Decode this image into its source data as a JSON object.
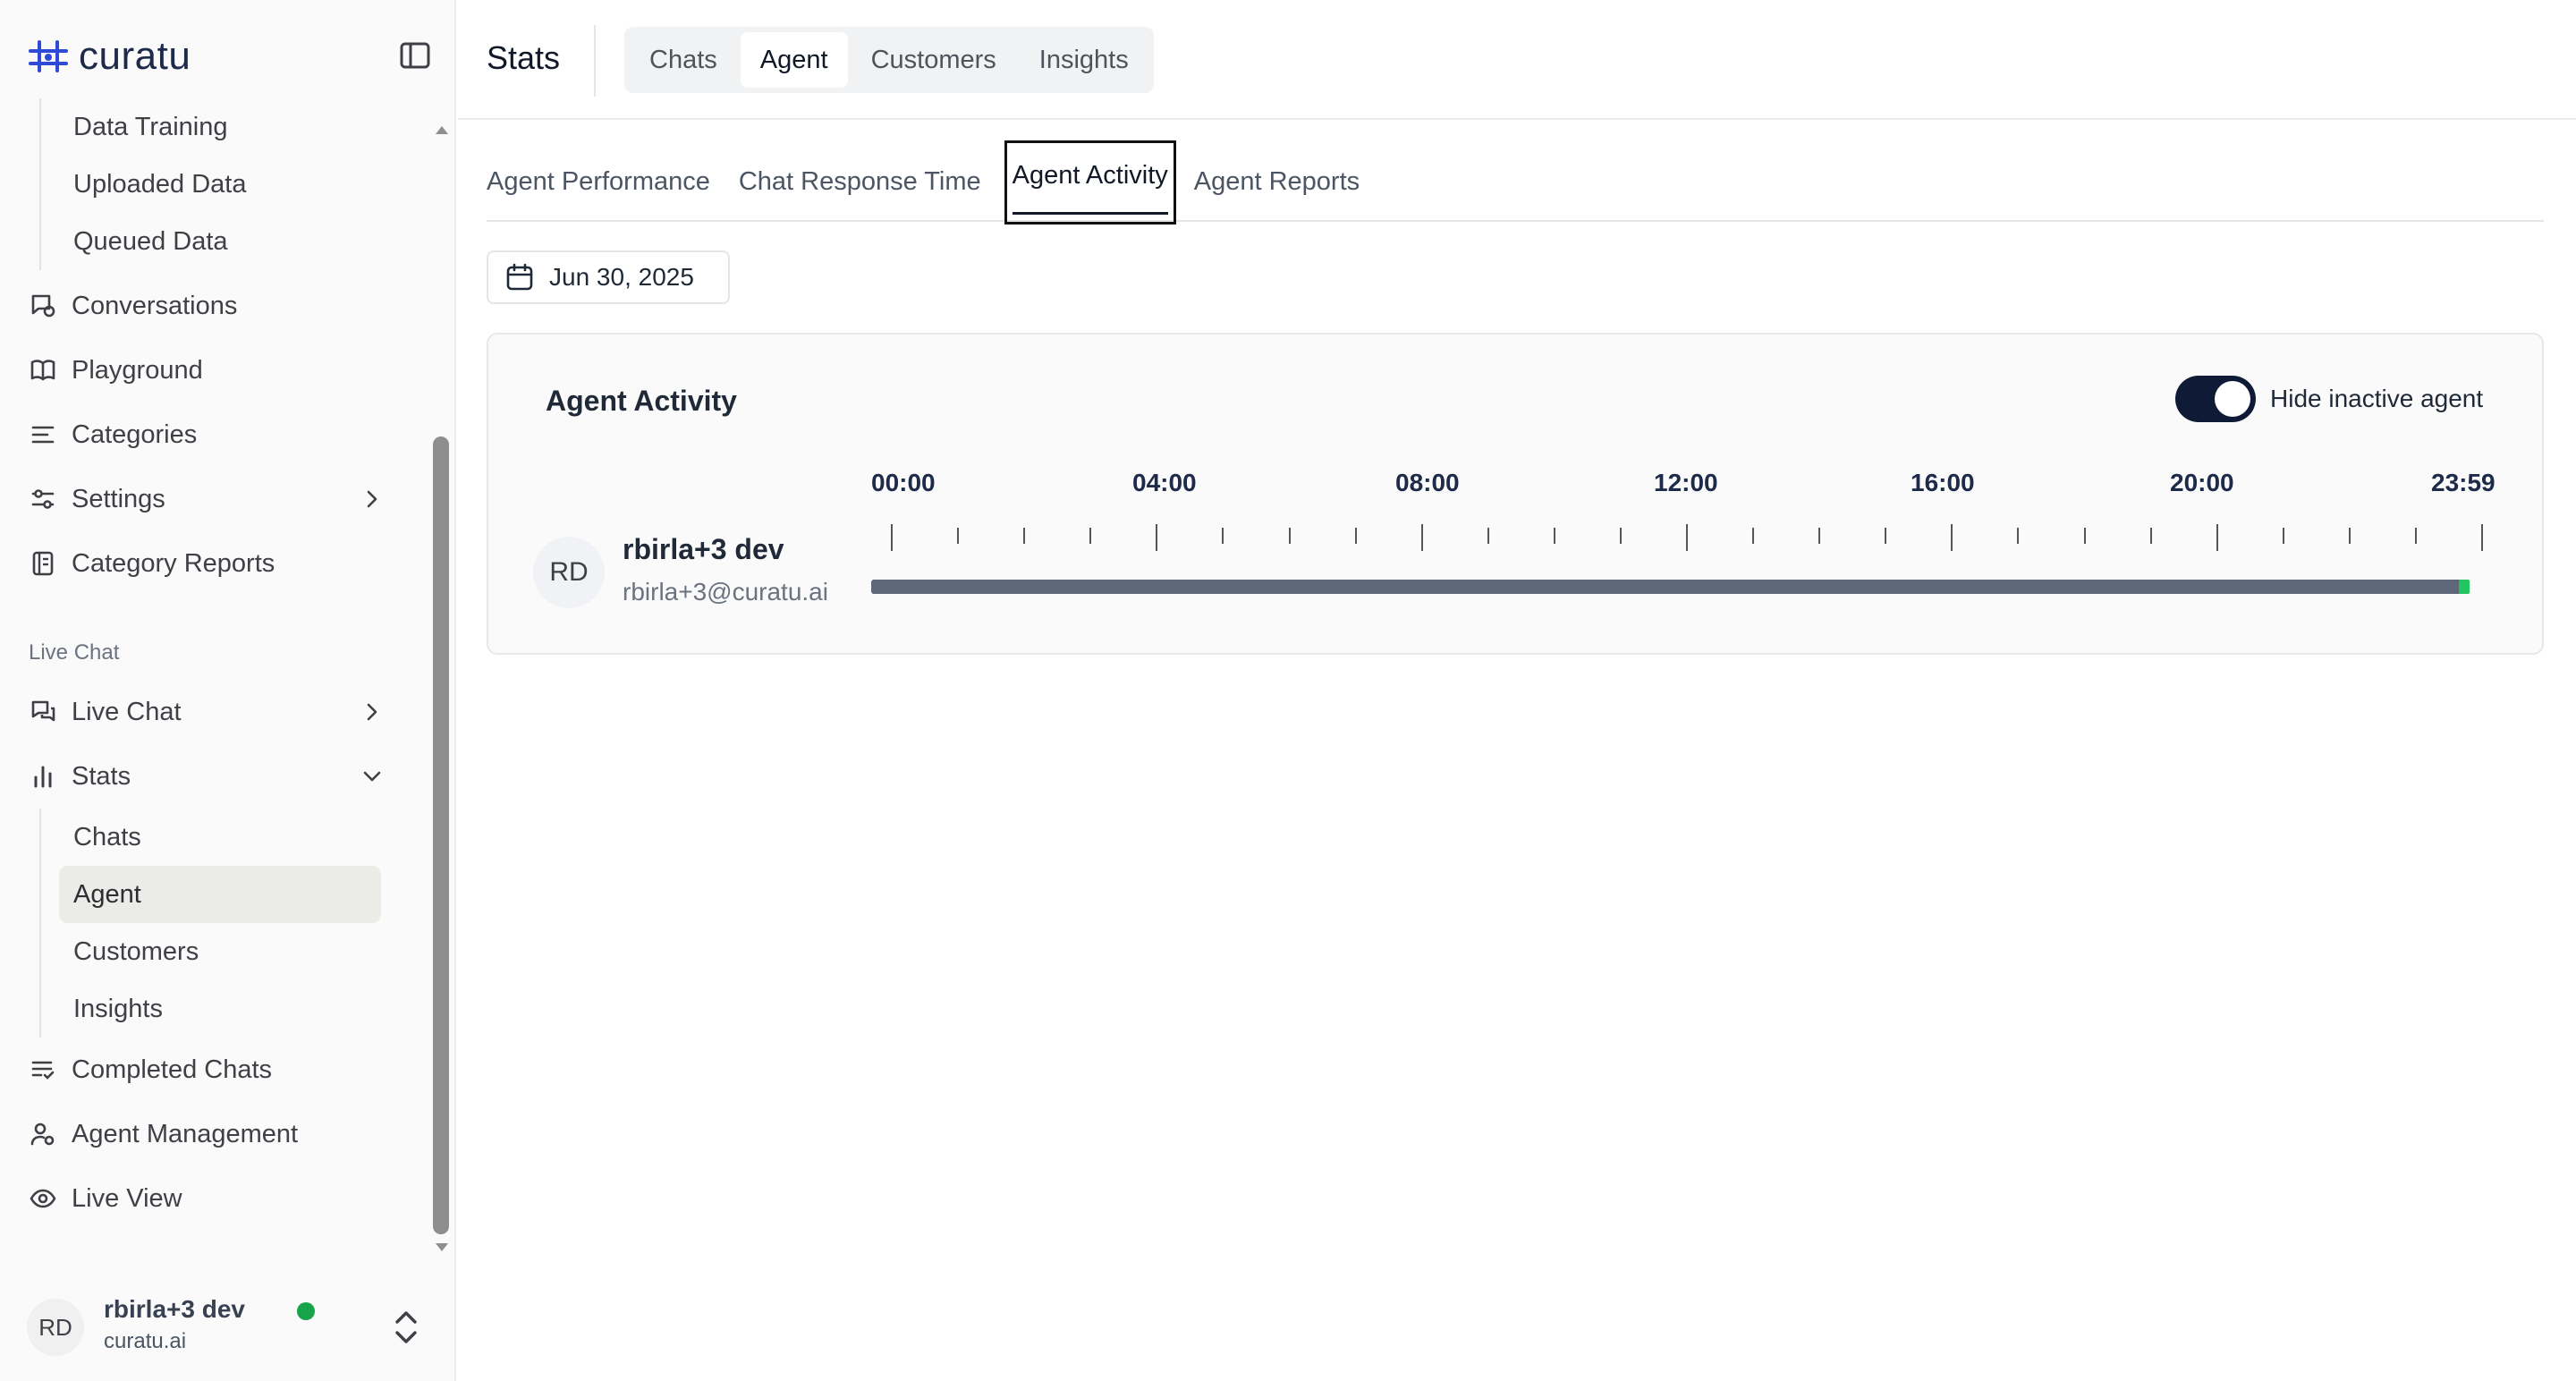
{
  "brand": {
    "name": "curatu",
    "color": "#2f4ad6"
  },
  "sidebar": {
    "top_subitems": [
      {
        "label": "Data Training"
      },
      {
        "label": "Uploaded Data"
      },
      {
        "label": "Queued Data"
      }
    ],
    "items_a": [
      {
        "label": "Conversations",
        "icon": "conversations-icon"
      },
      {
        "label": "Playground",
        "icon": "book-icon"
      },
      {
        "label": "Categories",
        "icon": "list-icon"
      },
      {
        "label": "Settings",
        "icon": "sliders-icon"
      },
      {
        "label": "Category Reports",
        "icon": "report-icon"
      }
    ],
    "section_label": "Live Chat",
    "items_b": [
      {
        "label": "Live Chat",
        "icon": "chat-icon"
      },
      {
        "label": "Stats",
        "icon": "bar-chart-icon"
      }
    ],
    "stats_subitems": [
      {
        "label": "Chats"
      },
      {
        "label": "Agent"
      },
      {
        "label": "Customers"
      },
      {
        "label": "Insights"
      }
    ],
    "items_c": [
      {
        "label": "Completed Chats",
        "icon": "list-check-icon"
      },
      {
        "label": "Agent Management",
        "icon": "user-gear-icon"
      },
      {
        "label": "Live View",
        "icon": "eye-icon"
      }
    ],
    "user": {
      "initials": "RD",
      "name": "rbirla+3 dev",
      "domain": "curatu.ai",
      "status_color": "#16a34a"
    }
  },
  "header": {
    "title": "Stats",
    "tabs": [
      {
        "label": "Chats"
      },
      {
        "label": "Agent"
      },
      {
        "label": "Customers"
      },
      {
        "label": "Insights"
      }
    ]
  },
  "subtabs": [
    {
      "label": "Agent Performance"
    },
    {
      "label": "Chat Response Time"
    },
    {
      "label": "Agent Activity"
    },
    {
      "label": "Agent Reports"
    }
  ],
  "date": "Jun 30, 2025",
  "card": {
    "title": "Agent Activity",
    "toggle_label": "Hide inactive agent",
    "toggle_on": true,
    "time_labels": [
      "00:00",
      "04:00",
      "08:00",
      "12:00",
      "16:00",
      "20:00",
      "23:59"
    ],
    "agent": {
      "initials": "RD",
      "name": "rbirla+3 dev",
      "email": "rbirla+3@curatu.ai",
      "timeline_end_fraction": 0.982,
      "active_segment_fraction": 0.007,
      "bar_color": "#5c6878",
      "active_color": "#22c55e"
    }
  }
}
